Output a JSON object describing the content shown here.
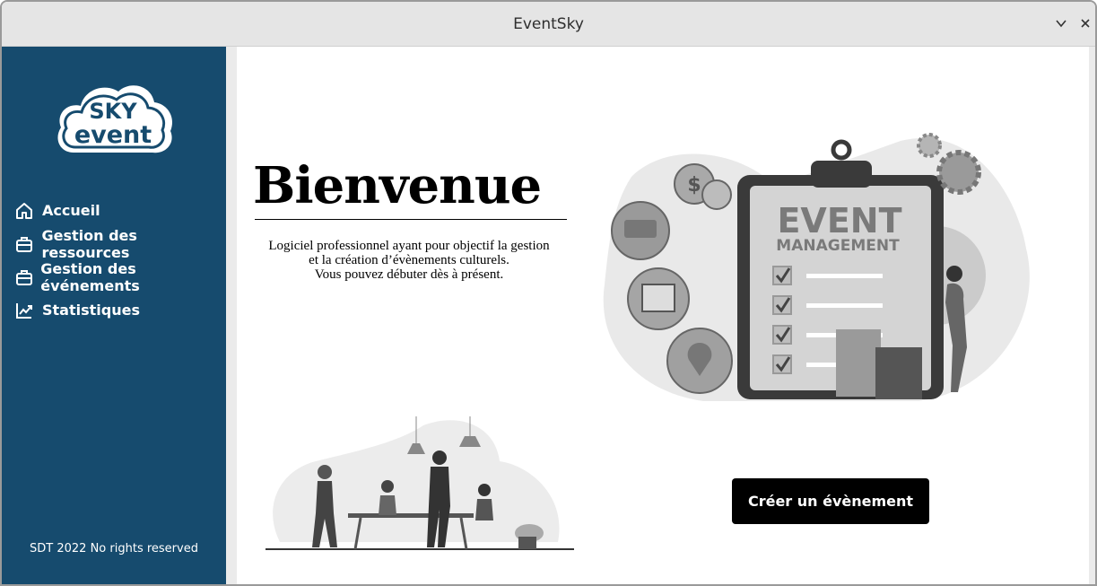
{
  "window": {
    "title": "EventSky"
  },
  "sidebar": {
    "logo_top": "SKY",
    "logo_bottom": "event",
    "items": [
      {
        "label": "Accueil",
        "icon": "home-icon"
      },
      {
        "label": "Gestion des ressources",
        "icon": "briefcase-icon"
      },
      {
        "label": "Gestion des événements",
        "icon": "briefcase-icon"
      },
      {
        "label": "Statistiques",
        "icon": "chart-line-icon"
      }
    ],
    "footer": "SDT 2022 No rights reserved"
  },
  "main": {
    "heading": "Bienvenue",
    "description_lines": [
      "Logiciel professionnel ayant pour objectif la gestion",
      "et la création d’évènements culturels.",
      "Vous pouvez débuter dès à présent."
    ],
    "hero": {
      "line1": "EVENT",
      "line2": "MANAGEMENT"
    },
    "cta_label": "Créer un évènement"
  },
  "colors": {
    "sidebar": "#164b6e",
    "titlebar": "#e5e5e5",
    "cta": "#000000"
  }
}
